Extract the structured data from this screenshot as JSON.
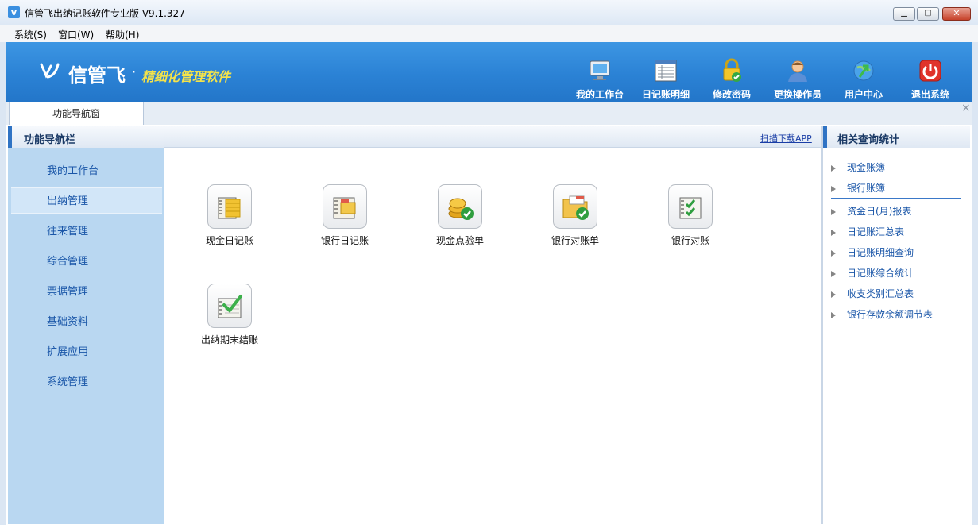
{
  "window": {
    "title": "信管飞出纳记账软件专业版 V9.1.327",
    "app_icon": "app-logo-icon",
    "controls": {
      "minimize": "minimize-icon",
      "maximize": "maximize-icon",
      "close": "close-icon"
    }
  },
  "menu": [
    {
      "label": "系统(S)"
    },
    {
      "label": "窗口(W)"
    },
    {
      "label": "帮助(H)"
    }
  ],
  "banner": {
    "brand": "信管飞",
    "dot": "·",
    "slogan": "精细化管理软件",
    "tools": [
      {
        "label": "我的工作台",
        "icon": "monitor-icon"
      },
      {
        "label": "日记账明细",
        "icon": "list-table-icon"
      },
      {
        "label": "修改密码",
        "icon": "padlock-icon"
      },
      {
        "label": "更换操作员",
        "icon": "user-icon"
      },
      {
        "label": "用户中心",
        "icon": "globe-arrow-icon"
      },
      {
        "label": "退出系统",
        "icon": "power-icon"
      }
    ]
  },
  "tabs": [
    {
      "label": "功能导航窗"
    }
  ],
  "left_panel": {
    "title": "功能导航栏",
    "items": [
      {
        "label": "我的工作台"
      },
      {
        "label": "出纳管理",
        "active": true
      },
      {
        "label": "往来管理"
      },
      {
        "label": "综合管理"
      },
      {
        "label": "票据管理"
      },
      {
        "label": "基础资料"
      },
      {
        "label": "扩展应用"
      },
      {
        "label": "系统管理"
      }
    ]
  },
  "center": {
    "scan_link": "扫描下载APP",
    "functions": [
      {
        "label": "现金日记账",
        "icon": "cash-journal-icon"
      },
      {
        "label": "银行日记账",
        "icon": "bank-journal-icon"
      },
      {
        "label": "现金点验单",
        "icon": "coin-check-icon"
      },
      {
        "label": "银行对账单",
        "icon": "folder-check-icon"
      },
      {
        "label": "银行对账",
        "icon": "notebook-check-icon"
      },
      {
        "label": "出纳期末结账",
        "icon": "period-close-icon"
      }
    ]
  },
  "right_panel": {
    "title": "相关查询统计",
    "items": [
      {
        "label": "现金账簿"
      },
      {
        "label": "银行账簿"
      },
      {
        "label": "资金日(月)报表"
      },
      {
        "label": "日记账汇总表"
      },
      {
        "label": "日记账明细查询"
      },
      {
        "label": "日记账综合统计"
      },
      {
        "label": "收支类别汇总表"
      },
      {
        "label": "银行存款余额调节表"
      }
    ]
  },
  "colors": {
    "banner": "#2b82d5",
    "slogan": "#f4e34a",
    "nav_bg": "#b9d7f1",
    "link": "#1a56a8"
  }
}
